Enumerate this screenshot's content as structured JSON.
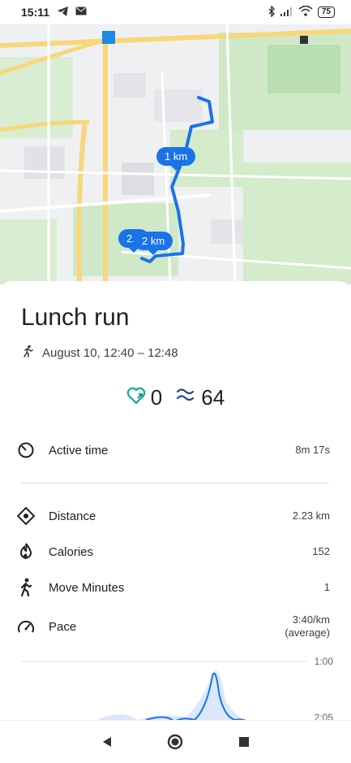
{
  "status_bar": {
    "time": "15:11",
    "battery": "75",
    "icons": [
      "telegram-icon",
      "mail-icon",
      "bluetooth-icon",
      "signal-icon",
      "wifi-icon",
      "battery-icon"
    ]
  },
  "map": {
    "markers": [
      {
        "label": "1 km"
      },
      {
        "label": "2 km"
      },
      {
        "label": "2.2"
      }
    ],
    "route_color": "#1a73e8"
  },
  "activity": {
    "title": "Lunch run",
    "date_range": "August 10, 12:40 – 12:48",
    "heart_points": "0",
    "steps": "64"
  },
  "metrics": [
    {
      "icon": "timer-icon",
      "label": "Active time",
      "value": "8m 17s"
    },
    {
      "icon": "location-diamond-icon",
      "label": "Distance",
      "value": "2.23 km"
    },
    {
      "icon": "flame-icon",
      "label": "Calories",
      "value": "152"
    },
    {
      "icon": "walking-icon",
      "label": "Move Minutes",
      "value": "1"
    },
    {
      "icon": "speedometer-icon",
      "label": "Pace",
      "value": "3:40/km",
      "value_sub": "(average)"
    }
  ],
  "pace_chart": {
    "ticks": [
      "1:00",
      "2:05"
    ]
  },
  "colors": {
    "accent": "#1a73e8",
    "heart": "#00a39b",
    "steps": "#1a4a8c"
  }
}
